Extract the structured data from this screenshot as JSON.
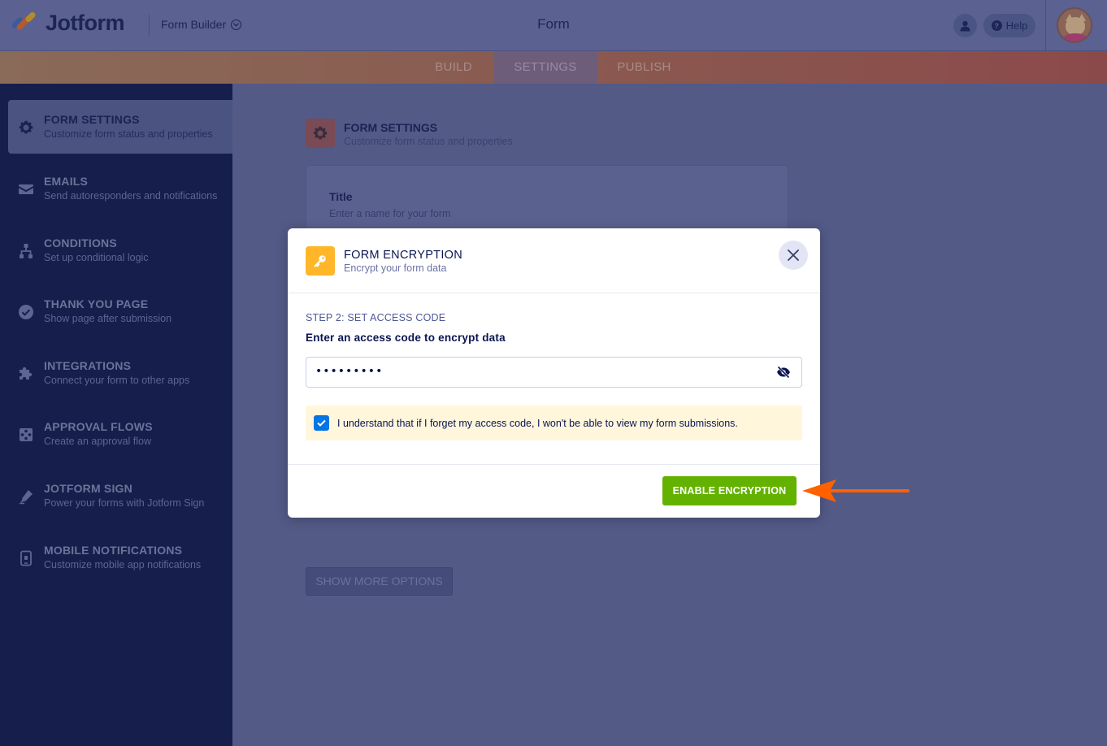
{
  "header": {
    "brand": "Jotform",
    "builder_label": "Form Builder",
    "page_title": "Form",
    "help_label": "Help"
  },
  "tabs": [
    {
      "label": "BUILD"
    },
    {
      "label": "SETTINGS"
    },
    {
      "label": "PUBLISH"
    }
  ],
  "sidebar": {
    "items": [
      {
        "title": "FORM SETTINGS",
        "subtitle": "Customize form status and properties",
        "icon": "gear-icon",
        "active": true
      },
      {
        "title": "EMAILS",
        "subtitle": "Send autoresponders and notifications",
        "icon": "envelope-icon"
      },
      {
        "title": "CONDITIONS",
        "subtitle": "Set up conditional logic",
        "icon": "sitemap-icon"
      },
      {
        "title": "THANK YOU PAGE",
        "subtitle": "Show page after submission",
        "icon": "check-circle-icon"
      },
      {
        "title": "INTEGRATIONS",
        "subtitle": "Connect your form to other apps",
        "icon": "puzzle-icon"
      },
      {
        "title": "APPROVAL FLOWS",
        "subtitle": "Create an approval flow",
        "icon": "approval-flow-icon"
      },
      {
        "title": "JOTFORM SIGN",
        "subtitle": "Power your forms with Jotform Sign",
        "icon": "pen-icon"
      },
      {
        "title": "MOBILE NOTIFICATIONS",
        "subtitle": "Customize mobile app notifications",
        "icon": "mobile-icon"
      }
    ]
  },
  "main": {
    "section_title": "FORM SETTINGS",
    "section_subtitle": "Customize form status and properties",
    "title_label": "Title",
    "title_hint": "Enter a name for your form",
    "show_more_label": "SHOW MORE OPTIONS"
  },
  "modal": {
    "title": "FORM ENCRYPTION",
    "subtitle": "Encrypt your form data",
    "step_label": "STEP 2: SET ACCESS CODE",
    "prompt": "Enter an access code to encrypt data",
    "access_code_masked": "•••••••••",
    "acknowledge_text": "I understand that if I forget my access code, I won't be able to view my form submissions.",
    "acknowledge_checked": true,
    "enable_button_label": "ENABLE ENCRYPTION"
  },
  "colors": {
    "enable_button": "#64b200",
    "key_icon_bg": "#ffb629",
    "checkbox": "#0075e3",
    "annotation_arrow": "#ff6100"
  }
}
